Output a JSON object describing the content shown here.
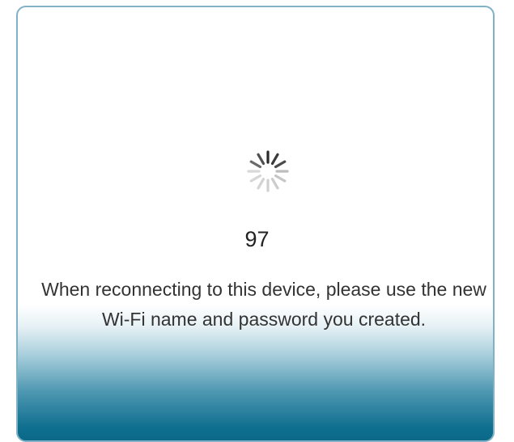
{
  "dialog": {
    "countdown": "97",
    "message": "When reconnecting to this device, please use the new Wi-Fi name and password you created.",
    "spinner_icon": "loading-spinner-icon"
  },
  "colors": {
    "border": "#7fb2c4",
    "gradient_bottom": "#0a6686",
    "text": "#333333"
  }
}
